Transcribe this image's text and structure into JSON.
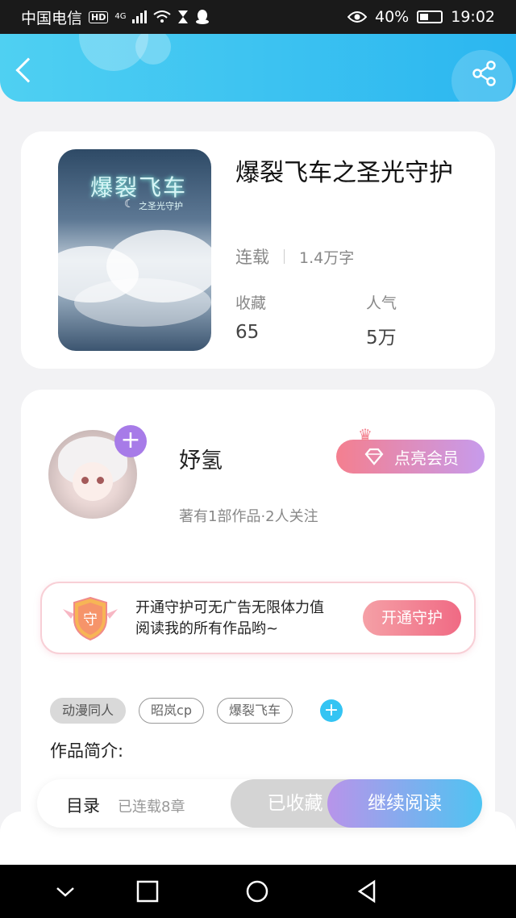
{
  "status_bar": {
    "carrier": "中国电信",
    "hd": "HD",
    "network": "4G",
    "battery": "40%",
    "time": "19:02"
  },
  "book": {
    "cover_title": "爆裂飞车",
    "cover_subtitle": "之圣光守护",
    "title": "爆裂飞车之圣光守护",
    "status": "连载",
    "word_count": "1.4万字",
    "favorites_label": "收藏",
    "favorites_value": "65",
    "popularity_label": "人气",
    "popularity_value": "5万"
  },
  "author": {
    "name": "妤氢",
    "info": "著有1部作品·2人关注",
    "vip_label": "点亮会员"
  },
  "guard": {
    "icon_text": "守",
    "line1": "开通守护可无广告无限体力值",
    "line2": "阅读我的所有作品哟~",
    "button": "开通守护"
  },
  "tags": [
    "动漫同人",
    "昭岚cp",
    "爆裂飞车"
  ],
  "intro": {
    "label": "作品简介:"
  },
  "actions": {
    "toc": "目录",
    "chapters": "已连载8章",
    "collected": "已收藏",
    "continue_reading": "继续阅读"
  },
  "icons": {
    "back": "back-arrow-icon",
    "share": "share-icon",
    "follow": "plus-icon",
    "crown": "crown-icon",
    "diamond": "diamond-icon",
    "tag_add": "plus-icon"
  },
  "colors": {
    "header": "#2bb6f0",
    "accent_purple": "#a77be8",
    "vip_gradient_start": "#f47f8f",
    "read_gradient_end": "#4ec4f2"
  }
}
